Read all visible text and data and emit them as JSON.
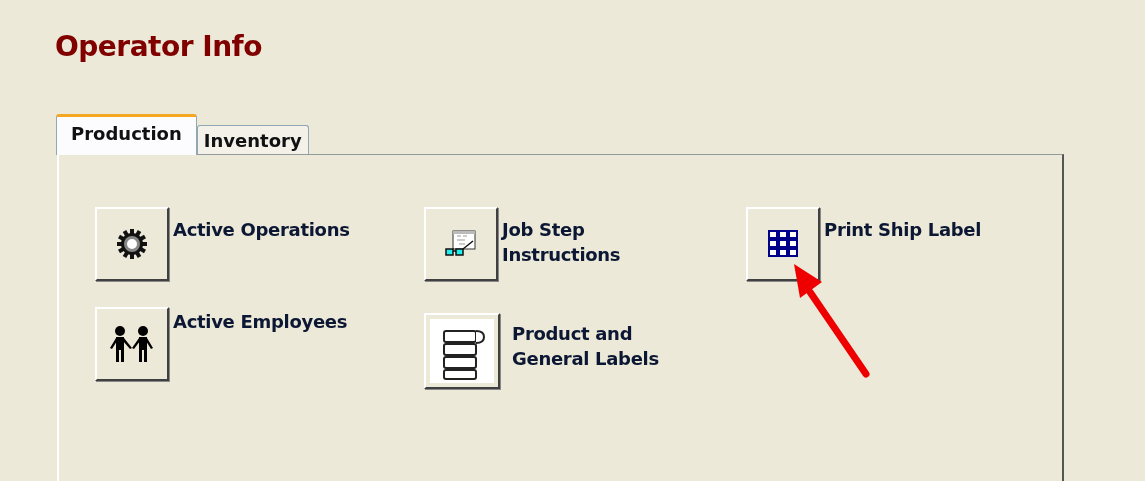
{
  "title": "Operator Info",
  "tabs": [
    {
      "label": "Production",
      "selected": true
    },
    {
      "label": "Inventory",
      "selected": false
    }
  ],
  "buttons": [
    {
      "kind": "gear",
      "label": "Active Operations"
    },
    {
      "kind": "instructions",
      "label": "Job Step Instructions"
    },
    {
      "kind": "grid",
      "label": "Print Ship Label"
    },
    {
      "kind": "people",
      "label": "Active Employees"
    },
    {
      "kind": "labels",
      "label": "Product and General Labels"
    }
  ]
}
